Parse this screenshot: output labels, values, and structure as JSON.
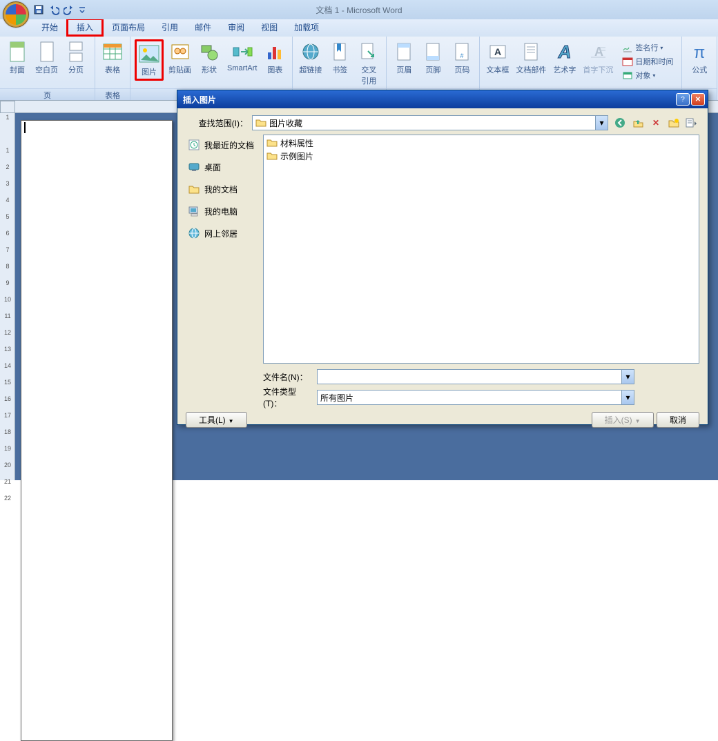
{
  "app": {
    "title": "文档 1 - Microsoft Word"
  },
  "tabs": {
    "home": "开始",
    "insert": "插入",
    "layout": "页面布局",
    "references": "引用",
    "mail": "邮件",
    "review": "审阅",
    "view": "视图",
    "addins": "加载项"
  },
  "ribbon": {
    "group_page": "页",
    "cover": "封面",
    "blank": "空白页",
    "break": "分页",
    "group_table": "表格",
    "table": "表格",
    "picture": "图片",
    "clipart": "剪贴画",
    "shapes": "形状",
    "smartart": "SmartArt",
    "chart": "图表",
    "hyperlink": "超链接",
    "bookmark": "书签",
    "crossref1": "交叉",
    "crossref2": "引用",
    "header": "页眉",
    "footer": "页脚",
    "pagenum": "页码",
    "textbox": "文本框",
    "wordparts": "文档部件",
    "wordart": "艺术字",
    "dropcap": "首字下沉",
    "signature": "签名行",
    "datetime": "日期和时间",
    "object": "对象",
    "equation": "公式"
  },
  "dialog": {
    "title": "插入图片",
    "lookin_label": "查找范围(I)：",
    "lookin_value": "图片收藏",
    "places": {
      "recent": "我最近的文档",
      "desktop": "桌面",
      "mydocs": "我的文档",
      "mycomputer": "我的电脑",
      "network": "网上邻居"
    },
    "files": [
      "材料属性",
      "示例图片"
    ],
    "filename_label": "文件名(N)：",
    "filename_value": "",
    "filetype_label": "文件类型(T)：",
    "filetype_value": "所有图片",
    "tools_btn": "工具(L)",
    "insert_btn": "插入(S)",
    "cancel_btn": "取消"
  },
  "ruler_v": [
    "1",
    "",
    "1",
    "2",
    "3",
    "4",
    "5",
    "6",
    "7",
    "8",
    "9",
    "10",
    "11",
    "12",
    "13",
    "14",
    "15",
    "16",
    "17",
    "18",
    "19",
    "20",
    "21",
    "22"
  ]
}
